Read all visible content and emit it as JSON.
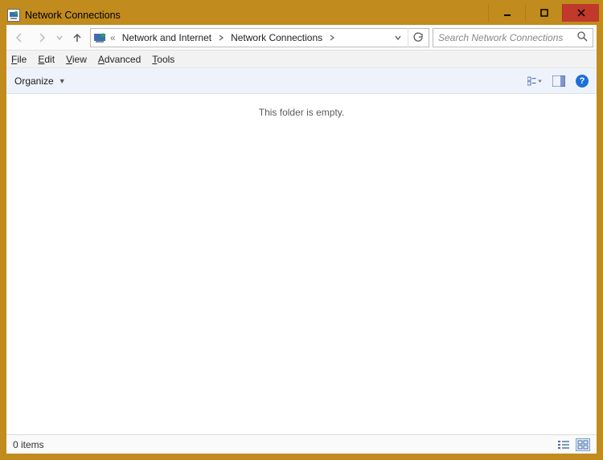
{
  "window": {
    "title": "Network Connections"
  },
  "nav": {
    "back_enabled": false,
    "forward_enabled": false,
    "up_enabled": true
  },
  "breadcrumb": {
    "prefix": "«",
    "items": [
      "Network and Internet",
      "Network Connections"
    ]
  },
  "search": {
    "placeholder": "Search Network Connections"
  },
  "menu": {
    "file": "File",
    "edit": "Edit",
    "view": "View",
    "advanced": "Advanced",
    "tools": "Tools"
  },
  "cmdbar": {
    "organize": "Organize"
  },
  "content": {
    "empty_message": "This folder is empty."
  },
  "statusbar": {
    "item_count": "0 items"
  }
}
